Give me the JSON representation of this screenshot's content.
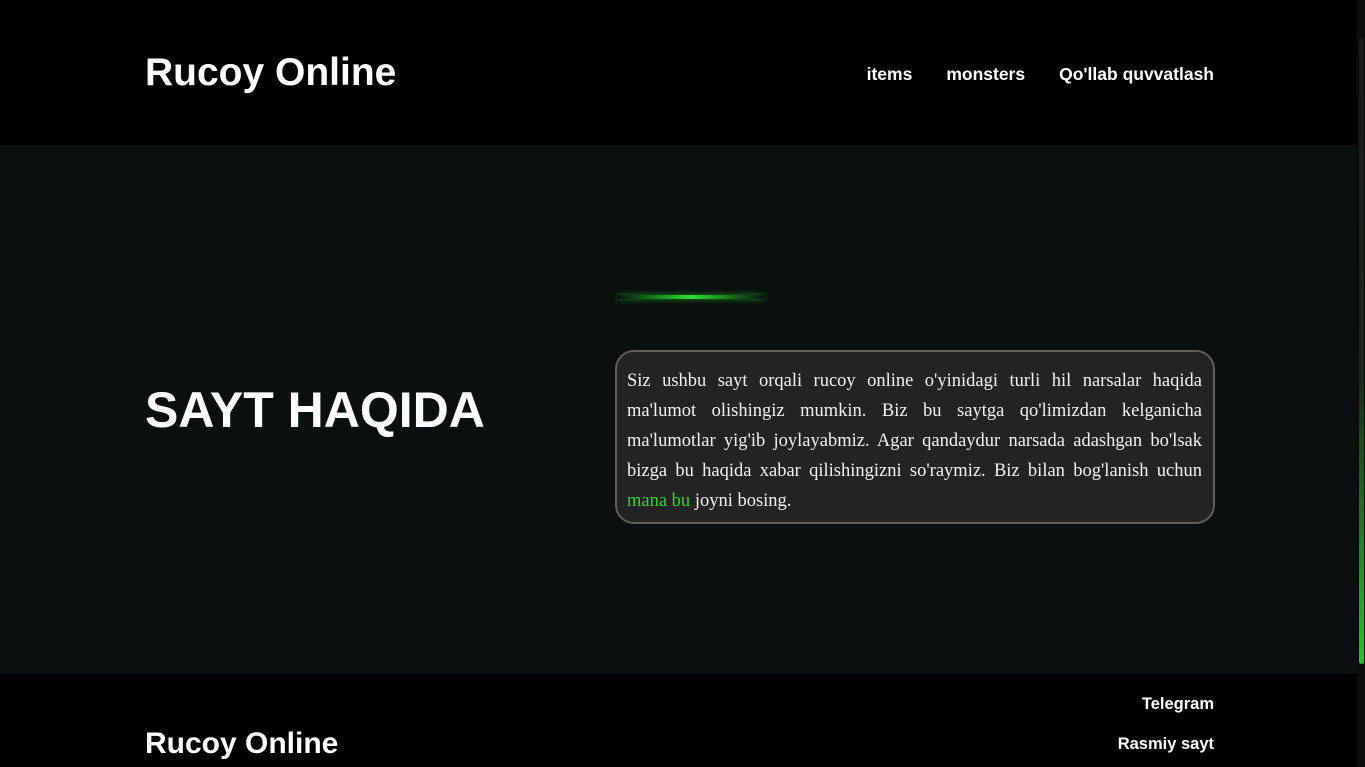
{
  "header": {
    "logo": "Rucoy Online",
    "nav": [
      {
        "label": "items"
      },
      {
        "label": "monsters"
      },
      {
        "label": "Qo'llab quvvatlash"
      }
    ]
  },
  "about": {
    "title": "SAYT HAQIDA",
    "text_before_link": "Siz ushbu sayt orqali rucoy online o'yinidagi turli hil narsalar haqida ma'lumot olishingiz mumkin. Biz bu saytga qo'limizdan kelganicha ma'lumotlar yig'ib joylayabmiz. Agar qandaydur narsada adashgan bo'lsak bizga bu haqida xabar qilishingizni so'raymiz. Biz bilan bog'lanish uchun ",
    "link_text": "mana bu",
    "text_after_link": " joyni bosing.",
    "accent_color": "#2ad92a"
  },
  "footer": {
    "logo": "Rucoy Online",
    "links": [
      {
        "label": "Telegram"
      },
      {
        "label": "Rasmiy sayt"
      }
    ]
  },
  "colors": {
    "header_bg": "#000000",
    "main_bg": "#0a0f10",
    "card_bg": "#232323",
    "accent": "#2ad92a"
  }
}
